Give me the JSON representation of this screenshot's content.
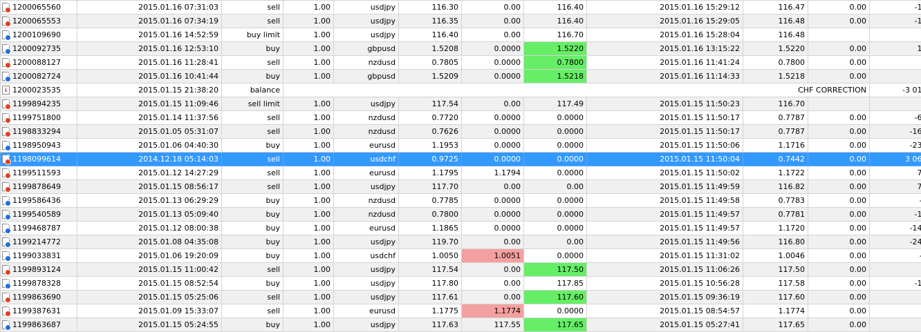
{
  "rows": [
    {
      "ticket": "1200065560",
      "open_time": "2015.01.16 07:31:03",
      "type": "sell",
      "size": "1.00",
      "symbol": "usdjpy",
      "price": "116.30",
      "sl": "0.00",
      "tp": "116.40",
      "close_time": "2015.01.16 15:29:12",
      "close_price": "116.47",
      "swap": "0.00",
      "profit": "-14.60",
      "icon": "doc-red",
      "comment": ""
    },
    {
      "ticket": "1200065553",
      "open_time": "2015.01.16 07:34:19",
      "type": "sell",
      "size": "1.00",
      "symbol": "usdjpy",
      "price": "116.35",
      "sl": "0.00",
      "tp": "116.40",
      "close_time": "2015.01.16 15:29:05",
      "close_price": "116.48",
      "swap": "0.00",
      "profit": "-11.16",
      "icon": "doc-red",
      "comment": ""
    },
    {
      "ticket": "1200109690",
      "open_time": "2015.01.16 14:52:59",
      "type": "buy limit",
      "size": "1.00",
      "symbol": "usdjpy",
      "price": "116.40",
      "sl": "0.00",
      "tp": "116.70",
      "close_time": "2015.01.16 15:28:04",
      "close_price": "116.48",
      "swap": "",
      "profit": "",
      "icon": "doc-blue",
      "comment": ""
    },
    {
      "ticket": "1200092735",
      "open_time": "2015.01.16 12:53:10",
      "type": "buy",
      "size": "1.00",
      "symbol": "gbpusd",
      "price": "1.5208",
      "sl": "0.0000",
      "tp": "1.5220",
      "close_time": "2015.01.16 13:15:22",
      "close_price": "1.5220",
      "swap": "0.00",
      "profit": "12.00",
      "icon": "doc-blue",
      "comment": "",
      "hl": "tp-green"
    },
    {
      "ticket": "1200088127",
      "open_time": "2015.01.16 11:28:41",
      "type": "sell",
      "size": "1.00",
      "symbol": "nzdusd",
      "price": "0.7805",
      "sl": "0.0000",
      "tp": "0.7800",
      "close_time": "2015.01.16 11:41:24",
      "close_price": "0.7800",
      "swap": "0.00",
      "profit": "5.00",
      "icon": "doc-red",
      "comment": "",
      "hl": "tp-green"
    },
    {
      "ticket": "1200082724",
      "open_time": "2015.01.16 10:41:44",
      "type": "buy",
      "size": "1.00",
      "symbol": "gbpusd",
      "price": "1.5209",
      "sl": "0.0000",
      "tp": "1.5218",
      "close_time": "2015.01.16 11:14:33",
      "close_price": "1.5218",
      "swap": "0.00",
      "profit": "9.00",
      "icon": "doc-blue",
      "comment": "",
      "hl": "tp-green"
    },
    {
      "ticket": "1200023535",
      "open_time": "2015.01.15 21:38:20",
      "type": "balance",
      "size": "",
      "symbol": "",
      "price": "",
      "sl": "",
      "tp": "",
      "close_time": "",
      "close_price": "",
      "swap": "",
      "profit": "-3 014.63",
      "icon": "balance",
      "comment": "CHF CORRECTION"
    },
    {
      "ticket": "1199894235",
      "open_time": "2015.01.15 11:09:46",
      "type": "sell limit",
      "size": "1.00",
      "symbol": "usdjpy",
      "price": "117.54",
      "sl": "0.00",
      "tp": "117.49",
      "close_time": "2015.01.15 11:50:23",
      "close_price": "116.70",
      "swap": "",
      "profit": "",
      "icon": "doc-red",
      "comment": ""
    },
    {
      "ticket": "1199751800",
      "open_time": "2015.01.14 11:37:56",
      "type": "sell",
      "size": "1.00",
      "symbol": "nzdusd",
      "price": "0.7720",
      "sl": "0.0000",
      "tp": "0.0000",
      "close_time": "2015.01.15 11:50:17",
      "close_price": "0.7787",
      "swap": "0.00",
      "profit": "-67.00",
      "icon": "doc-red",
      "comment": ""
    },
    {
      "ticket": "1198833294",
      "open_time": "2015.01.05 05:31:07",
      "type": "sell",
      "size": "1.00",
      "symbol": "nzdusd",
      "price": "0.7626",
      "sl": "0.0000",
      "tp": "0.0000",
      "close_time": "2015.01.15 11:50:17",
      "close_price": "0.7787",
      "swap": "0.00",
      "profit": "-161.00",
      "icon": "doc-red",
      "comment": ""
    },
    {
      "ticket": "1198950943",
      "open_time": "2015.01.06 04:40:30",
      "type": "buy",
      "size": "1.00",
      "symbol": "eurusd",
      "price": "1.1953",
      "sl": "0.0000",
      "tp": "0.0000",
      "close_time": "2015.01.15 11:50:06",
      "close_price": "1.1716",
      "swap": "0.00",
      "profit": "-237.00",
      "icon": "doc-blue",
      "comment": ""
    },
    {
      "ticket": "1198099614",
      "open_time": "2014.12.18 05:14:03",
      "type": "sell",
      "size": "1.00",
      "symbol": "usdchf",
      "price": "0.9725",
      "sl": "0.0000",
      "tp": "0.0000",
      "close_time": "2015.01.15 11:50:04",
      "close_price": "0.7442",
      "swap": "0.00",
      "profit": "3 067.72",
      "icon": "doc-red",
      "comment": "",
      "selected": true
    },
    {
      "ticket": "1199511593",
      "open_time": "2015.01.12 14:27:29",
      "type": "sell",
      "size": "1.00",
      "symbol": "eurusd",
      "price": "1.1795",
      "sl": "1.1794",
      "tp": "0.0000",
      "close_time": "2015.01.15 11:50:02",
      "close_price": "1.1722",
      "swap": "0.00",
      "profit": "73.00",
      "icon": "doc-red",
      "comment": ""
    },
    {
      "ticket": "1199878649",
      "open_time": "2015.01.15 08:56:17",
      "type": "sell",
      "size": "1.00",
      "symbol": "usdjpy",
      "price": "117.70",
      "sl": "0.00",
      "tp": "0.00",
      "close_time": "2015.01.15 11:49:59",
      "close_price": "116.82",
      "swap": "0.00",
      "profit": "75.33",
      "icon": "doc-red",
      "comment": ""
    },
    {
      "ticket": "1199586436",
      "open_time": "2015.01.13 06:29:29",
      "type": "buy",
      "size": "1.00",
      "symbol": "nzdusd",
      "price": "0.7785",
      "sl": "0.0000",
      "tp": "0.0000",
      "close_time": "2015.01.15 11:49:58",
      "close_price": "0.7783",
      "swap": "0.00",
      "profit": "-2.00",
      "icon": "doc-blue",
      "comment": ""
    },
    {
      "ticket": "1199540589",
      "open_time": "2015.01.13 05:09:40",
      "type": "buy",
      "size": "1.00",
      "symbol": "nzdusd",
      "price": "0.7800",
      "sl": "0.0000",
      "tp": "0.0000",
      "close_time": "2015.01.15 11:49:57",
      "close_price": "0.7781",
      "swap": "0.00",
      "profit": "-19.00",
      "icon": "doc-blue",
      "comment": ""
    },
    {
      "ticket": "1199468787",
      "open_time": "2015.01.12 08:00:38",
      "type": "buy",
      "size": "1.00",
      "symbol": "eurusd",
      "price": "1.1865",
      "sl": "0.0000",
      "tp": "0.0000",
      "close_time": "2015.01.15 11:49:57",
      "close_price": "1.1720",
      "swap": "0.00",
      "profit": "-145.00",
      "icon": "doc-blue",
      "comment": ""
    },
    {
      "ticket": "1199214772",
      "open_time": "2015.01.08 04:35:08",
      "type": "buy",
      "size": "1.00",
      "symbol": "usdjpy",
      "price": "119.70",
      "sl": "0.00",
      "tp": "0.00",
      "close_time": "2015.01.15 11:49:56",
      "close_price": "116.80",
      "swap": "0.00",
      "profit": "-248.29",
      "icon": "doc-blue",
      "comment": ""
    },
    {
      "ticket": "1199033831",
      "open_time": "2015.01.06 19:20:09",
      "type": "buy",
      "size": "1.00",
      "symbol": "usdchf",
      "price": "1.0050",
      "sl": "1.0051",
      "tp": "0.0000",
      "close_time": "2015.01.15 11:31:02",
      "close_price": "1.0046",
      "swap": "0.00",
      "profit": "-3.98",
      "icon": "doc-blue",
      "comment": "",
      "hl": "sl-red"
    },
    {
      "ticket": "1199893124",
      "open_time": "2015.01.15 11:00:42",
      "type": "sell",
      "size": "1.00",
      "symbol": "usdjpy",
      "price": "117.54",
      "sl": "0.00",
      "tp": "117.50",
      "close_time": "2015.01.15 11:06:26",
      "close_price": "117.50",
      "swap": "0.00",
      "profit": "3.40",
      "icon": "doc-red",
      "comment": "",
      "hl": "tp-green"
    },
    {
      "ticket": "1199878328",
      "open_time": "2015.01.15 08:52:54",
      "type": "buy",
      "size": "1.00",
      "symbol": "usdjpy",
      "price": "117.80",
      "sl": "0.00",
      "tp": "117.85",
      "close_time": "2015.01.15 10:56:28",
      "close_price": "117.58",
      "swap": "0.00",
      "profit": "-18.71",
      "icon": "doc-blue",
      "comment": ""
    },
    {
      "ticket": "1199863690",
      "open_time": "2015.01.15 05:25:06",
      "type": "sell",
      "size": "1.00",
      "symbol": "usdjpy",
      "price": "117.61",
      "sl": "0.00",
      "tp": "117.60",
      "close_time": "2015.01.15 09:36:19",
      "close_price": "117.60",
      "swap": "0.00",
      "profit": "0.85",
      "icon": "doc-red",
      "comment": "",
      "hl": "tp-green"
    },
    {
      "ticket": "1199387631",
      "open_time": "2015.01.09 15:33:07",
      "type": "sell",
      "size": "1.00",
      "symbol": "eurusd",
      "price": "1.1775",
      "sl": "1.1774",
      "tp": "0.0000",
      "close_time": "2015.01.15 08:54:57",
      "close_price": "1.1774",
      "swap": "0.00",
      "profit": "1.00",
      "icon": "doc-red",
      "comment": "",
      "hl": "sl-red"
    },
    {
      "ticket": "1199863687",
      "open_time": "2015.01.15 05:24:55",
      "type": "buy",
      "size": "1.00",
      "symbol": "usdjpy",
      "price": "117.63",
      "sl": "117.55",
      "tp": "117.65",
      "close_time": "2015.01.15 05:27:41",
      "close_price": "117.65",
      "swap": "0.00",
      "profit": "1.70",
      "icon": "doc-blue",
      "comment": "",
      "hl": "tp-green"
    }
  ],
  "colors": {
    "selected_row": "#3399ff",
    "tp_hit": "#66ee66",
    "sl_hit": "#f5a0a0",
    "alt_row": "#f0f0f0",
    "buy_dot": "#1f6fd8",
    "sell_dot": "#e04020"
  }
}
